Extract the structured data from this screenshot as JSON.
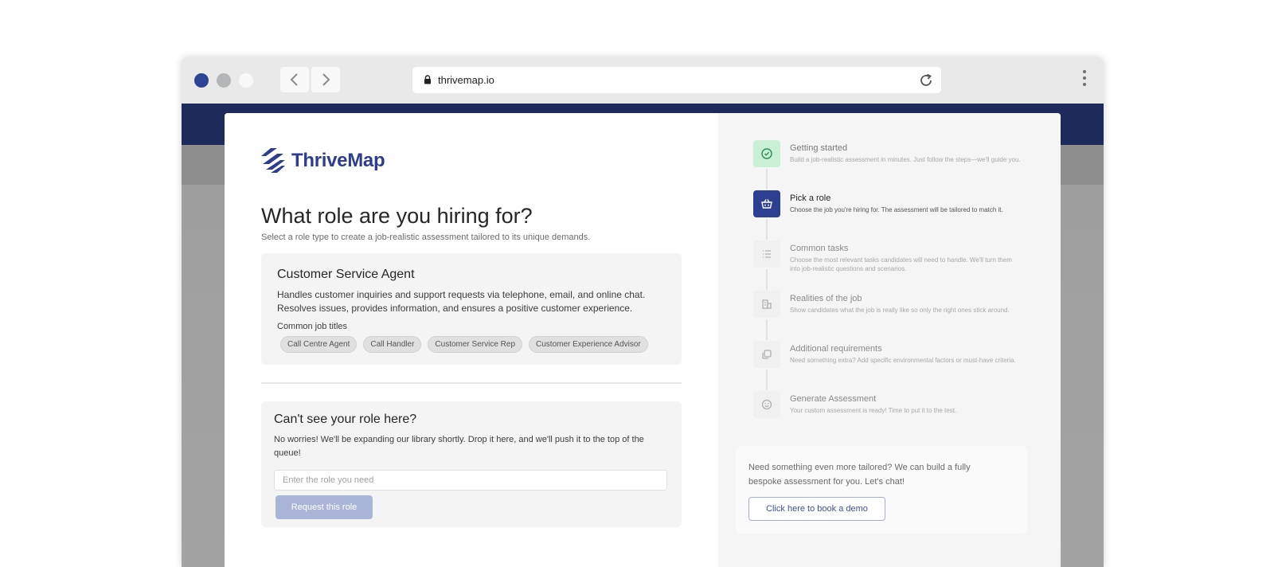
{
  "browser": {
    "url": "thrivemap.io",
    "window_dot_colors": [
      "#2d4494",
      "#b3b5b6",
      "#f8f8f8"
    ]
  },
  "brand": {
    "name": "ThriveMap",
    "color": "#2d3d8f"
  },
  "main": {
    "title": "What role are you hiring for?",
    "subtitle": "Select a role type to create a job-realistic assessment tailored to its unique demands.",
    "role_card": {
      "title": "Customer Service Agent",
      "description": "Handles customer inquiries and support requests via telephone, email, and online chat. Resolves issues, provides information, and ensures a positive customer experience.",
      "common_label": "Common job titles",
      "chips": [
        "Call Centre Agent",
        "Call Handler",
        "Customer Service Rep",
        "Customer Experience Advisor"
      ]
    },
    "cant_see": {
      "title": "Can't see your role here?",
      "description": "No worries! We'll be expanding our library shortly. Drop it here, and we'll push it to the top of the queue!",
      "input_placeholder": "Enter the role you need",
      "button_label": "Request this role"
    }
  },
  "steps": [
    {
      "title": "Getting started",
      "desc": "Build a job-realistic assessment in minutes. Just follow the steps—we'll guide you.",
      "state": "done",
      "icon": "check-circle-icon"
    },
    {
      "title": "Pick a role",
      "desc": "Choose the job you're hiring for. The assessment will be tailored to match it.",
      "state": "active",
      "icon": "basket-icon"
    },
    {
      "title": "Common tasks",
      "desc": "Choose the most relevant tasks candidates will need to handle. We'll turn them into job-realistic questions and scenarios.",
      "state": "pending",
      "icon": "list-icon"
    },
    {
      "title": "Realities of the job",
      "desc": "Show candidates what the job is really like so only the right ones stick around.",
      "state": "pending",
      "icon": "building-icon"
    },
    {
      "title": "Additional requirements",
      "desc": "Need something extra? Add specific environmental factors or must-have criteria.",
      "state": "pending",
      "icon": "copy-icon"
    },
    {
      "title": "Generate Assessment",
      "desc": "Your custom assessment is ready! Time to put it to the test.",
      "state": "pending",
      "icon": "smile-icon"
    }
  ],
  "demo": {
    "text": "Need something even more tailored? We can build a fully bespoke assessment for you. Let's chat!",
    "button_label": "Click here to book a demo"
  }
}
